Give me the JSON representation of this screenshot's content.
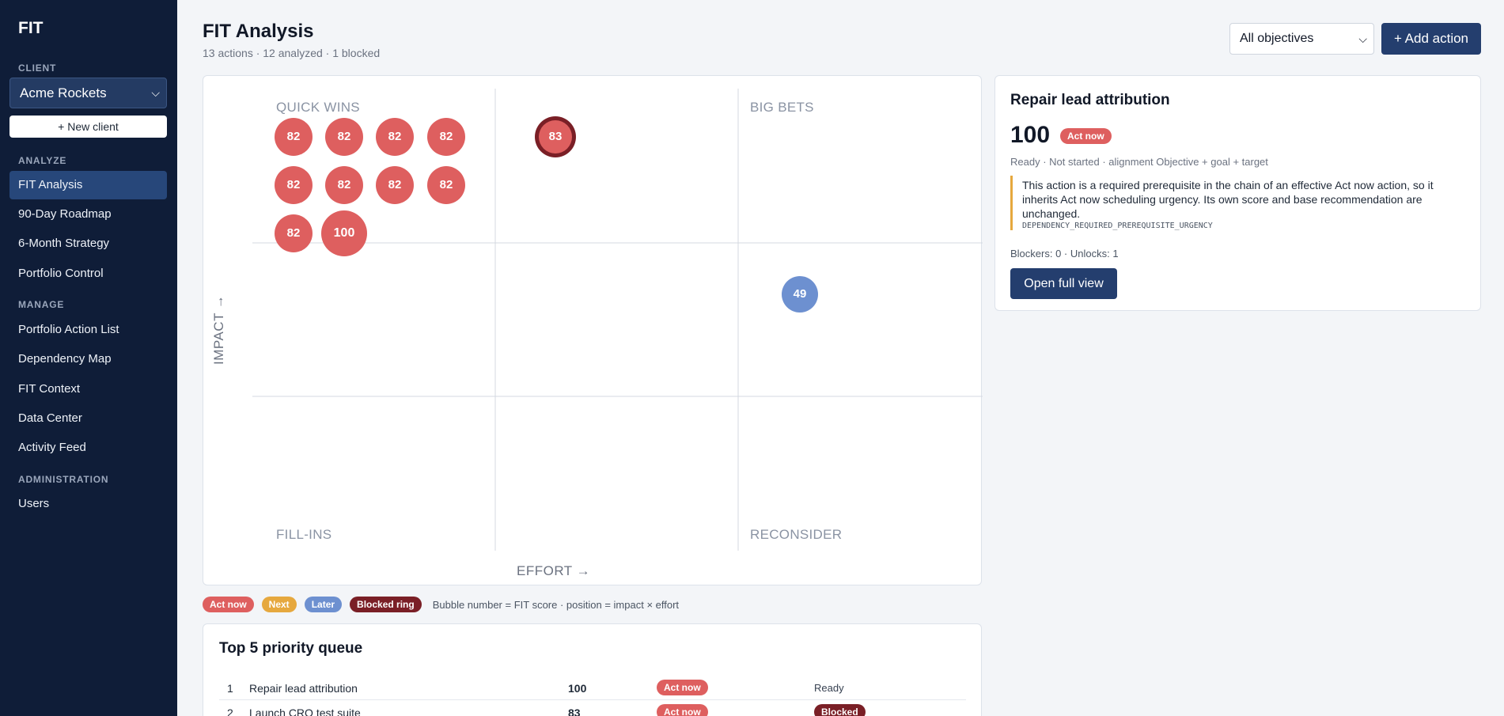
{
  "sidebar": {
    "brand": "FIT",
    "client_section": "CLIENT",
    "client_selected": "Acme Rockets",
    "new_client": "+ New client",
    "analyze_section": "ANALYZE",
    "analyze_items": [
      "FIT Analysis",
      "90-Day Roadmap",
      "6-Month Strategy",
      "Portfolio Control"
    ],
    "manage_section": "MANAGE",
    "manage_items": [
      "Portfolio Action List",
      "Dependency Map",
      "FIT Context",
      "Data Center",
      "Activity Feed"
    ],
    "admin_section": "ADMINISTRATION",
    "admin_items": [
      "Users"
    ],
    "active_item": "FIT Analysis"
  },
  "header": {
    "title": "FIT Analysis",
    "subtitle": "13 actions · 12 analyzed · 1 blocked",
    "objective_filter": "All objectives",
    "add_action": "+ Add action"
  },
  "matrix": {
    "quadrants": {
      "top_left": "QUICK WINS",
      "top_right": "BIG BETS",
      "bottom_left": "FILL-INS",
      "bottom_right": "RECONSIDER"
    },
    "x_axis": "EFFORT →",
    "y_axis": "IMPACT →",
    "colors": {
      "act_now": "#de5f5f",
      "later": "#6d90d0",
      "blocked_ring": "#7a1f26"
    },
    "bubbles": [
      {
        "score": "82",
        "status": "act_now"
      },
      {
        "score": "82",
        "status": "act_now"
      },
      {
        "score": "82",
        "status": "act_now"
      },
      {
        "score": "82",
        "status": "act_now"
      },
      {
        "score": "82",
        "status": "act_now"
      },
      {
        "score": "82",
        "status": "act_now"
      },
      {
        "score": "82",
        "status": "act_now"
      },
      {
        "score": "82",
        "status": "act_now"
      },
      {
        "score": "82",
        "status": "act_now"
      },
      {
        "score": "100",
        "status": "act_now"
      },
      {
        "score": "83",
        "status": "act_now",
        "blocked": true
      },
      {
        "score": "49",
        "status": "later"
      }
    ]
  },
  "legend": {
    "act_now": "Act now",
    "next": "Next",
    "later": "Later",
    "blocked": "Blocked ring",
    "note": "Bubble number = FIT score · position = impact × effort",
    "colors": {
      "act_now": "#de5f5f",
      "next": "#e6a83e",
      "later": "#6d90d0",
      "blocked": "#7a1f26"
    }
  },
  "queue": {
    "title": "Top 5 priority queue",
    "rows": [
      {
        "rank": "1",
        "name": "Repair lead attribution",
        "score": "100",
        "badge": "Act now",
        "state": "Ready"
      },
      {
        "rank": "2",
        "name": "Launch CRO test suite",
        "score": "83",
        "badge": "Act now",
        "state": "Blocked"
      }
    ]
  },
  "detail": {
    "title": "Repair lead attribution",
    "score": "100",
    "badge": "Act now",
    "meta": "Ready · Not started · alignment Objective + goal + target",
    "note": "This action is a required prerequisite in the chain of an effective Act now action, so it inherits Act now scheduling urgency. Its own score and base recommendation are unchanged.",
    "note_code": "DEPENDENCY_REQUIRED_PREREQUISITE_URGENCY",
    "counts": "Blockers: 0 · Unlocks: 1",
    "open_button": "Open full view"
  }
}
